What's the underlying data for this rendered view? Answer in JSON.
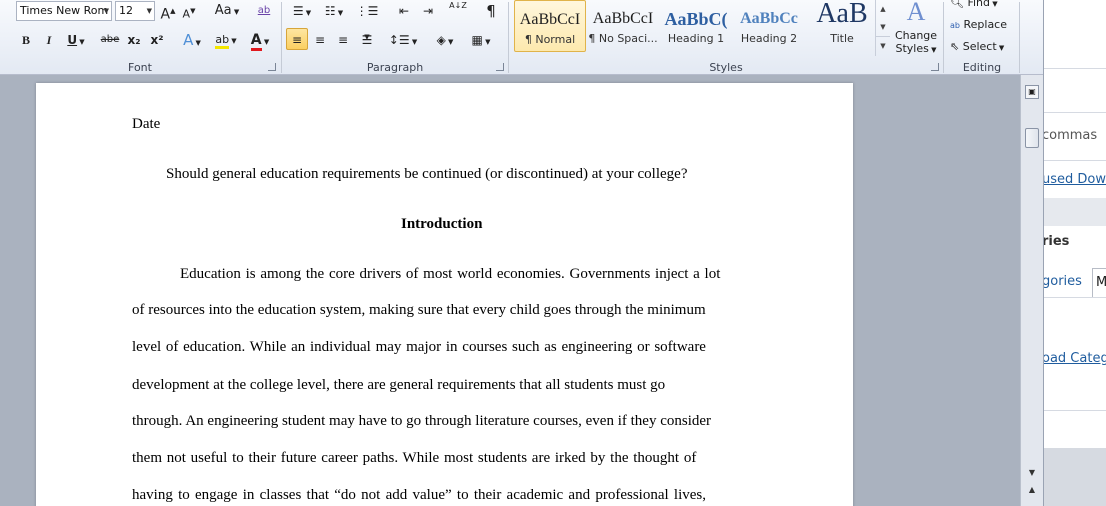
{
  "font": {
    "family_value": "Times New Rom",
    "size_value": "12",
    "grow_label": "A",
    "shrink_label": "A",
    "case_label": "Aa",
    "clear_label": "ab",
    "bold": "B",
    "italic": "I",
    "underline": "U",
    "strike": "abe",
    "subscript": "x₂",
    "superscript": "x²",
    "effects_label": "A",
    "highlight_label": "ab",
    "color_label": "A",
    "group_label": "Font"
  },
  "paragraph": {
    "sort_label": "A↓Z",
    "pilcrow": "¶",
    "group_label": "Paragraph"
  },
  "styles": {
    "items": [
      {
        "sample": "AaBbCcI",
        "label": "¶ Normal"
      },
      {
        "sample": "AaBbCcI",
        "label": "¶ No Spaci..."
      },
      {
        "sample": "AaBbC(",
        "label": "Heading 1"
      },
      {
        "sample": "AaBbCc",
        "label": "Heading 2"
      },
      {
        "sample": "AaB",
        "label": "Title"
      }
    ],
    "change_label_1": "Change",
    "change_label_2": "Styles",
    "group_label": "Styles"
  },
  "editing": {
    "find_label": "Find",
    "replace_label": "Replace",
    "select_label": "Select",
    "group_label": "Editing"
  },
  "pane": {
    "commas": "commas",
    "used_down": "used Down",
    "ries": "ries",
    "gories": "gories",
    "m": "M",
    "oad_catego": "oad Catego"
  },
  "document": {
    "date": "Date",
    "question": "Should general education requirements be continued (or discontinued) at your college?",
    "heading": "Introduction",
    "lines": [
      "Education is among the core drivers of most world economies. Governments inject a lot",
      "of resources into the education system, making sure that every child goes through the minimum",
      "level of education. While an individual may major in courses such as engineering or software",
      "development at the college level, there are general requirements that all students must go",
      "through. An engineering student may have to go through literature courses, even if they consider",
      "them not useful to their future career paths. While most students are irked by the thought of",
      "having to engage in classes that “do not add value” to their academic and professional lives,"
    ]
  }
}
